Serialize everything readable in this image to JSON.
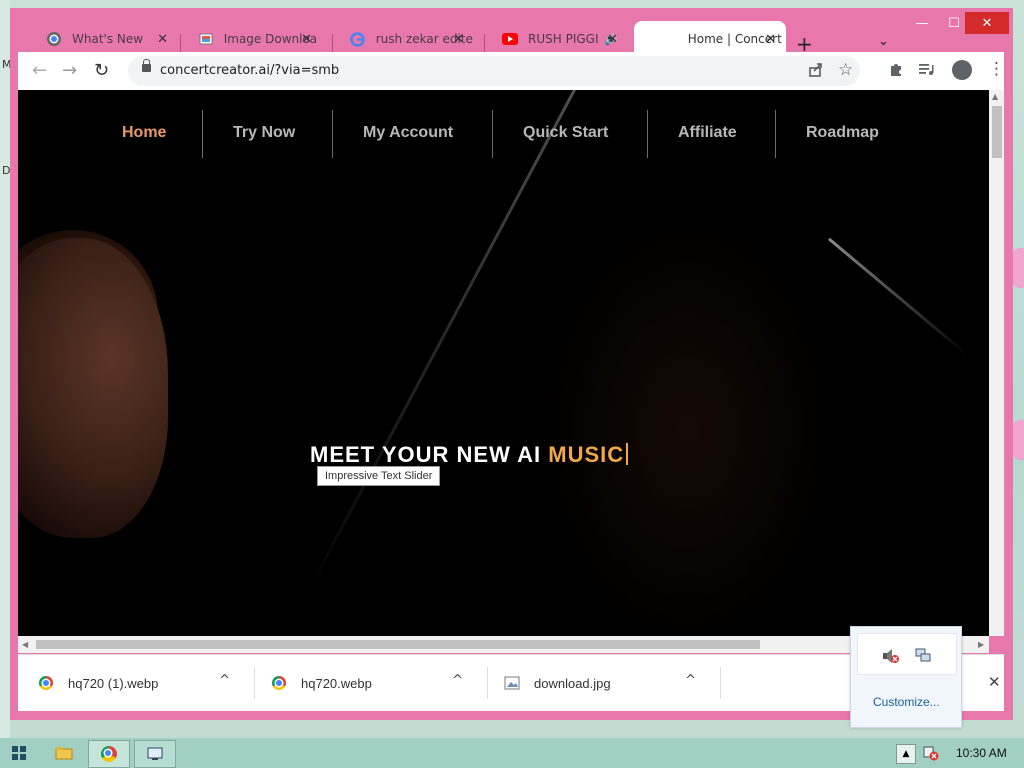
{
  "desktop": {
    "edge_letters": [
      "M",
      "D"
    ]
  },
  "window": {
    "controls": {
      "minimize": "—",
      "maximize": "☐",
      "close": "✕"
    },
    "tabs": [
      {
        "label": "What's New",
        "icon": "chrome-icon",
        "close": "✕"
      },
      {
        "label": "Image Downloa",
        "icon": "image-icon",
        "close": "✕"
      },
      {
        "label": "rush zekar edite",
        "icon": "google-icon",
        "close": "✕"
      },
      {
        "label": "RUSH PIGGI",
        "icon": "youtube-icon",
        "audio": "🔊",
        "close": "✕"
      },
      {
        "label": "Home | Concert",
        "icon": "none",
        "close": "✕",
        "active": true
      }
    ],
    "new_tab": "+",
    "tab_search": "⌄"
  },
  "toolbar": {
    "back": "←",
    "forward": "→",
    "reload": "↻",
    "url": "concertcreator.ai/?via=smb",
    "share_icon": "share-icon",
    "bookmark_icon": "star-icon",
    "extensions_icon": "puzzle-icon",
    "media_icon": "media-queue-icon",
    "menu": "⋮"
  },
  "page": {
    "nav": [
      {
        "label": "Home",
        "active": true
      },
      {
        "label": "Try Now"
      },
      {
        "label": "My Account"
      },
      {
        "label": "Quick Start"
      },
      {
        "label": "Affiliate"
      },
      {
        "label": "Roadmap"
      }
    ],
    "headline_main": "MEET YOUR NEW AI ",
    "headline_accent": "MUSIC",
    "tooltip": "Impressive Text Slider"
  },
  "downloads": [
    {
      "name": "hq720 (1).webp",
      "icon": "chrome-icon",
      "chevron": "^"
    },
    {
      "name": "hq720.webp",
      "icon": "chrome-icon",
      "chevron": "^"
    },
    {
      "name": "download.jpg",
      "icon": "image-file-icon",
      "chevron": "^"
    }
  ],
  "downloads_close": "✕",
  "tray_popup": {
    "customize": "Customize..."
  },
  "taskbar": {
    "clock": "10:30 AM"
  },
  "colors": {
    "window_frame": "#e878ac",
    "accent": "#e59a68",
    "headline_accent": "#f0a94a"
  }
}
